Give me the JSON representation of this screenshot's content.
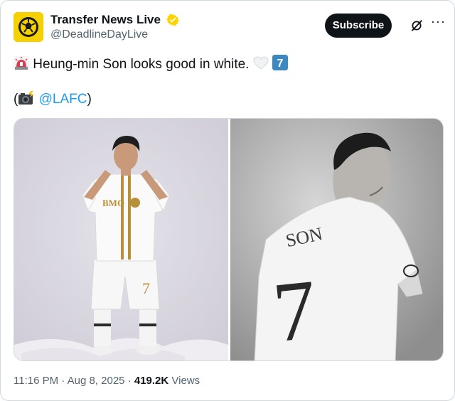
{
  "account": {
    "display_name": "Transfer News Live",
    "handle": "@DeadlineDayLive",
    "verified": true
  },
  "actions": {
    "subscribe_label": "Subscribe",
    "more_label": "···"
  },
  "tweet": {
    "text_line1": "Heung-min Son looks good in white.",
    "text_line2_open": "(",
    "mention": "@LAFC",
    "text_line2_close": ")",
    "emoji_siren": "siren-emoji",
    "emoji_heart": "white-heart-emoji",
    "emoji_keycap": "keycap-seven-emoji",
    "keycap_number": "7",
    "emoji_camera": "camera-flash-emoji"
  },
  "media": {
    "left_photo": {
      "jersey_sponsor": "BMO",
      "shorts_number": "7"
    },
    "right_photo": {
      "back_name": "SON",
      "back_number": "7"
    }
  },
  "meta": {
    "time": "11:16 PM",
    "separator": "·",
    "date": "Aug 8, 2025",
    "views_count": "419.2K",
    "views_label": "Views"
  },
  "colors": {
    "accent": "#1d9bf0",
    "gold_badge": "#ffd400",
    "avatar_bg": "#f6d100",
    "button_bg": "#0f1419",
    "keycap_blue": "#3b88c3"
  }
}
